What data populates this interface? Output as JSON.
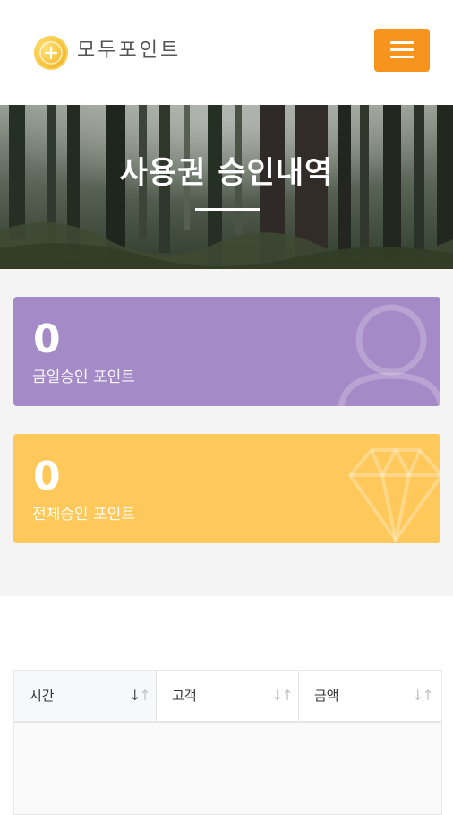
{
  "header": {
    "app_name": "모두포인트",
    "logo_icon": "coin-plus-icon",
    "menu_icon": "hamburger-icon",
    "menu_color": "#f7941d"
  },
  "hero": {
    "title": "사용권 승인내역"
  },
  "cards": [
    {
      "value": "0",
      "label": "금일승인 포인트",
      "icon": "user-icon",
      "color": "#a48ac6"
    },
    {
      "value": "0",
      "label": "전체승인 포인트",
      "icon": "diamond-icon",
      "color": "#fec95a"
    }
  ],
  "table": {
    "columns": [
      {
        "label": "시간",
        "sort_icon": "sort-icon"
      },
      {
        "label": "고객",
        "sort_icon": "sort-icon"
      },
      {
        "label": "금액",
        "sort_icon": "sort-icon"
      }
    ]
  }
}
